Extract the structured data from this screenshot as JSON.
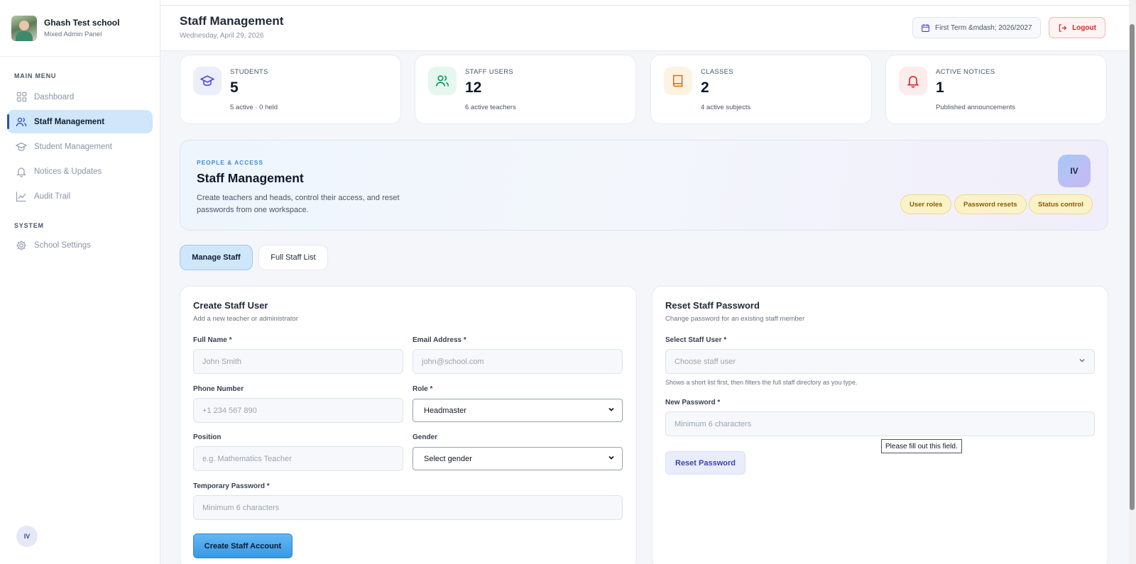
{
  "sidebar": {
    "school_name": "Ghash Test school",
    "panel_label": "Mixed Admin Panel",
    "main_menu_label": "MAIN MENU",
    "system_label": "SYSTEM",
    "items": [
      {
        "label": "Dashboard",
        "icon": "grid-icon"
      },
      {
        "label": "Staff Management",
        "icon": "users-icon",
        "active": true
      },
      {
        "label": "Student Management",
        "icon": "graduation-cap-icon"
      },
      {
        "label": "Notices & Updates",
        "icon": "bell-icon"
      },
      {
        "label": "Audit Trail",
        "icon": "line-chart-icon"
      }
    ],
    "system_items": [
      {
        "label": "School Settings",
        "icon": "gear-icon"
      }
    ],
    "user_initials": "IV"
  },
  "header": {
    "title": "Staff Management",
    "date": "Wednesday, April 29, 2026",
    "term": "First Term &mdash; 2026/2027",
    "logout_label": "Logout"
  },
  "stats": [
    {
      "label": "STUDENTS",
      "value": "5",
      "sub": "5 active · 0 held",
      "icon": "graduation-cap-icon",
      "color": "#4f46e5"
    },
    {
      "label": "STAFF USERS",
      "value": "12",
      "sub": "6 active teachers",
      "icon": "users-icon",
      "color": "#059669"
    },
    {
      "label": "CLASSES",
      "value": "2",
      "sub": "4 active subjects",
      "icon": "book-icon",
      "color": "#d97706"
    },
    {
      "label": "ACTIVE NOTICES",
      "value": "1",
      "sub": "Published announcements",
      "icon": "bell-icon",
      "color": "#dc2626"
    }
  ],
  "hero": {
    "eyebrow": "PEOPLE & ACCESS",
    "title": "Staff Management",
    "description": "Create teachers and heads, control their access, and reset passwords from one workspace.",
    "avatar_initials": "IV",
    "chips": [
      "User roles",
      "Password resets",
      "Status control"
    ]
  },
  "tabs": [
    {
      "label": "Manage Staff",
      "active": true
    },
    {
      "label": "Full Staff List",
      "active": false
    }
  ],
  "create_form": {
    "title": "Create Staff User",
    "subtitle": "Add a new teacher or administrator",
    "full_name_label": "Full Name *",
    "full_name_placeholder": "John Smith",
    "email_label": "Email Address *",
    "email_placeholder": "john@school.com",
    "phone_label": "Phone Number",
    "phone_placeholder": "+1 234 567 890",
    "role_label": "Role *",
    "role_value": "Headmaster",
    "position_label": "Position",
    "position_placeholder": "e.g. Mathematics Teacher",
    "gender_label": "Gender",
    "gender_value": "Select gender",
    "password_label": "Temporary Password *",
    "password_placeholder": "Minimum 6 characters",
    "submit_label": "Create Staff Account"
  },
  "reset_form": {
    "title": "Reset Staff Password",
    "subtitle": "Change password for an existing staff member",
    "select_label": "Select Staff User *",
    "select_placeholder": "Choose staff user",
    "hint": "Shows a short list first, then filters the full staff directory as you type.",
    "new_password_label": "New Password *",
    "new_password_placeholder": "Minimum 6 characters",
    "tooltip": "Please fill out this field.",
    "submit_label": "Reset Password"
  },
  "colors": {
    "accent": "#3a98e2",
    "active_nav": "#cfe6fb",
    "danger": "#dc2626"
  }
}
